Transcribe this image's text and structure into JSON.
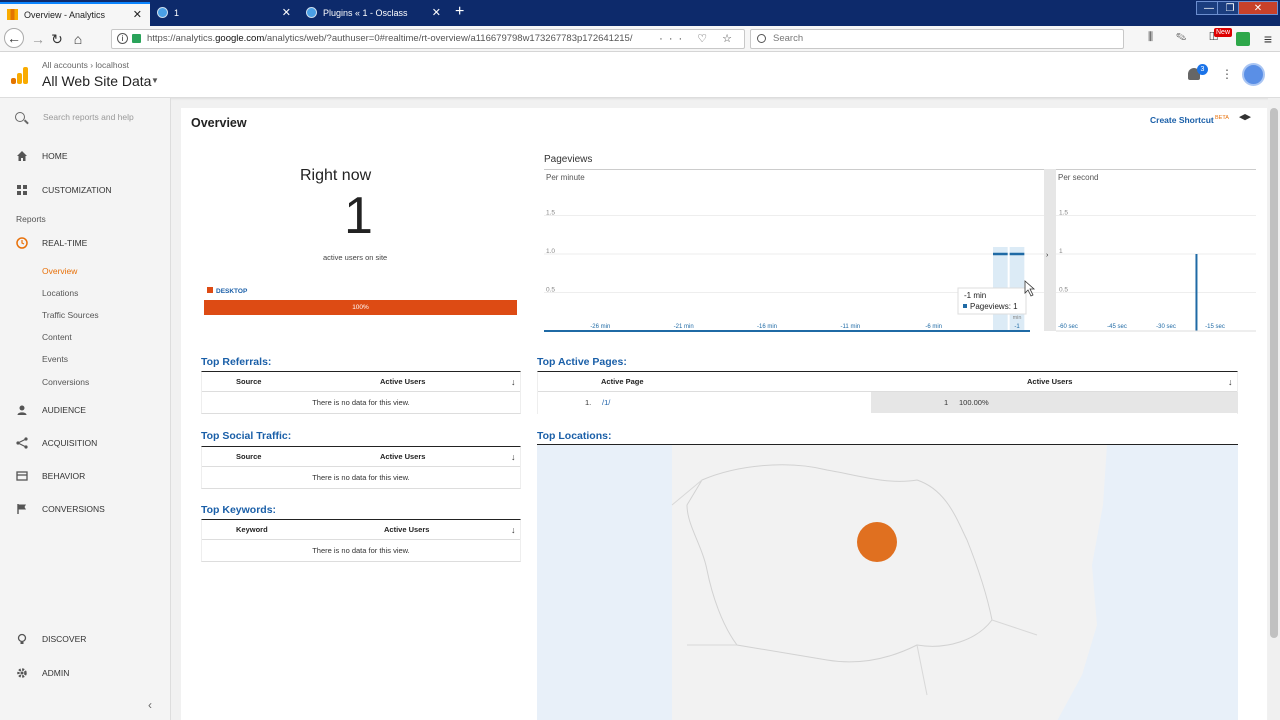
{
  "browser": {
    "tabs": [
      {
        "title": "Overview - Analytics",
        "favicon": "ga-favicon-icon",
        "active": true
      },
      {
        "title": "1",
        "favicon": "globe-icon",
        "active": false
      },
      {
        "title": "Plugins « 1 - Osclass",
        "favicon": "globe-icon",
        "active": false
      }
    ],
    "tab_close": "✕",
    "newtab": "+",
    "url_prefix": "https://analytics.",
    "url_domain": "google.com",
    "url_rest": "/analytics/web/?authuser=0#realtime/rt-overview/a116679798w173267783p172641215/",
    "url_actions": "··· ♡ ☆",
    "search_placeholder": "Search",
    "new_badge": "New",
    "toolbar_icons": "⫼ ✎ ◫",
    "window_controls": [
      "—",
      "❐",
      "✕"
    ],
    "menu_icon": "≡"
  },
  "ga_header": {
    "breadcrumb": "All accounts › localhost",
    "view_title": "All Web Site Data",
    "caret": "▼",
    "notifications": "3",
    "kebab": "⋮"
  },
  "sidebar": {
    "search_placeholder": "Search reports and help",
    "home": "HOME",
    "customization": "CUSTOMIZATION",
    "reports_label": "Reports",
    "realtime": "REAL-TIME",
    "sub_items": [
      "Overview",
      "Locations",
      "Traffic Sources",
      "Content",
      "Events",
      "Conversions"
    ],
    "audience": "AUDIENCE",
    "acquisition": "ACQUISITION",
    "behavior": "BEHAVIOR",
    "conversions": "CONVERSIONS",
    "discover": "DISCOVER",
    "admin": "ADMIN",
    "collapse": "‹"
  },
  "main": {
    "title": "Overview",
    "create_shortcut": "Create Shortcut",
    "beta": "BETA",
    "right_now": "Right now",
    "active_count": "1",
    "active_sub": "active users on site",
    "device_label": "DESKTOP",
    "device_pct_label": "100%",
    "device_share": 1.0,
    "pageviews_title": "Pageviews"
  },
  "colors": {
    "accent_orange": "#e8710a",
    "device_bar": "#dd4b14",
    "link_blue": "#1a5fa8",
    "chart_bar": "#1f6aa5",
    "chart_hover": "#dcebf6"
  },
  "chart_data": [
    {
      "type": "bar",
      "title": "Per minute",
      "x": [
        "-26 min",
        "-21 min",
        "-16 min",
        "-11 min",
        "-6 min",
        "-1"
      ],
      "yticks": [
        0.5,
        1.0,
        1.5
      ],
      "ytick_labels": [
        "0.5",
        "1.0",
        "1.5"
      ],
      "ylim": [
        0,
        2
      ],
      "bars": [
        {
          "minutes_ago": 2,
          "value": 1
        },
        {
          "minutes_ago": 1,
          "value": 1
        }
      ],
      "baseline_min": 0,
      "tooltip": {
        "label": "-1 min",
        "series": "Pageviews",
        "value": "1"
      },
      "last_label": "min"
    },
    {
      "type": "bar",
      "title": "Per second",
      "x": [
        "-60 sec",
        "-45 sec",
        "-30 sec",
        "-15 sec"
      ],
      "yticks": [
        0.5,
        1,
        1.5
      ],
      "ytick_labels": [
        "0.5",
        "1",
        "1.5"
      ],
      "ylim": [
        0,
        2
      ],
      "bars": [
        {
          "seconds_ago": 17,
          "value": 1
        }
      ]
    }
  ],
  "referrals": {
    "title": "Top Referrals:",
    "col1": "Source",
    "col2": "Active Users",
    "sort": "↓",
    "empty": "There is no data for this view."
  },
  "social": {
    "title": "Top Social Traffic:",
    "col1": "Source",
    "col2": "Active Users",
    "sort": "↓",
    "empty": "There is no data for this view."
  },
  "keywords": {
    "title": "Top Keywords:",
    "col1": "Keyword",
    "col2": "Active Users",
    "sort": "↓",
    "empty": "There is no data for this view."
  },
  "active_pages": {
    "title": "Top Active Pages:",
    "col1": "Active Page",
    "col2": "Active Users",
    "sort": "↓",
    "rows": [
      {
        "num": "1.",
        "path": "/1/",
        "users": "1",
        "pct": "100.00%"
      }
    ]
  },
  "locations": {
    "title": "Top Locations:",
    "marker_color": "#e07020"
  }
}
